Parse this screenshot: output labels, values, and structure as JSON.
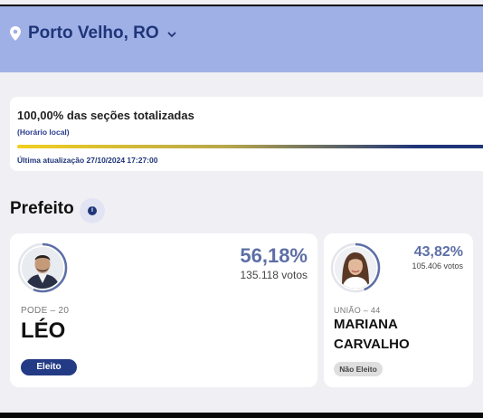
{
  "header": {
    "location": "Porto Velho, RO",
    "location_icon": "map-pin-icon",
    "dropdown_icon": "chevron-down-icon",
    "bg_color": "#9fb0e6",
    "text_color": "#1f3579"
  },
  "progress": {
    "title": "100,00% das seções totalizadas",
    "subtitle": "(Horário local)",
    "percent": 100,
    "last_update": "Última atualização 27/10/2024 17:27:00"
  },
  "section": {
    "title": "Prefeito",
    "info_icon": "info-icon"
  },
  "candidates": [
    {
      "party": "PODE – 20",
      "name": "LÉO",
      "percent": "56,18%",
      "votes": "135.118 votos",
      "vote_share": 56.18,
      "status": "Eleito",
      "status_color": "#233a84"
    },
    {
      "party": "UNIÃO – 44",
      "name_line1": "MARIANA",
      "name_line2": "CARVALHO",
      "percent": "43,82%",
      "votes": "105.406 votos",
      "vote_share": 43.82,
      "status": "Não Eleito",
      "status_color": "#dedede"
    }
  ]
}
